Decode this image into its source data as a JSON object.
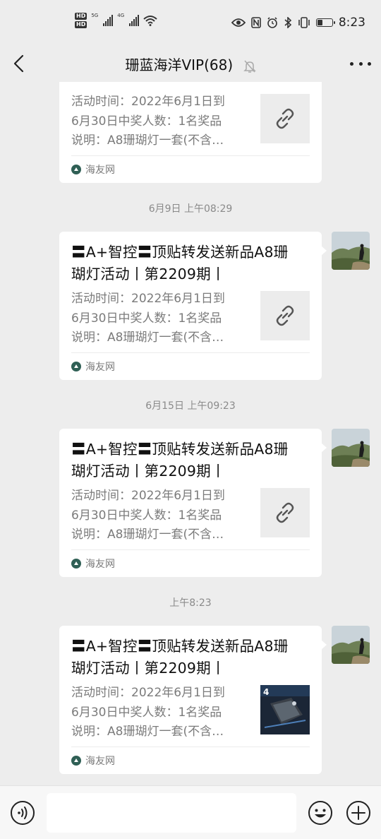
{
  "status_bar": {
    "hd_labels": [
      "HD",
      "HD"
    ],
    "net1": "5G",
    "net2": "4G",
    "time": "8:23",
    "battery_level": 0.35
  },
  "nav": {
    "title": "珊蓝海洋VIP(68)"
  },
  "messages": [
    {
      "title": "",
      "desc": [
        "活动时间：2022年6月1日到",
        "6月30日中奖人数：1名奖品",
        "说明：A8珊瑚灯一套(不含…"
      ],
      "thumb": "link-icon",
      "source": "海友网"
    },
    {
      "timestamp": "6月9日 上午08:29",
      "title": "〓A+智控〓顶贴转发送新品A8珊瑚灯活动丨第2209期丨",
      "title_lines": [
        "〓A+智控〓顶贴转发送新品A8珊",
        "瑚灯活动丨第2209期丨"
      ],
      "desc": [
        "活动时间：2022年6月1日到",
        "6月30日中奖人数：1名奖品",
        "说明：A8珊瑚灯一套(不含…"
      ],
      "thumb": "link-icon",
      "source": "海友网"
    },
    {
      "timestamp": "6月15日 上午09:23",
      "title_lines": [
        "〓A+智控〓顶贴转发送新品A8珊",
        "瑚灯活动丨第2209期丨"
      ],
      "desc": [
        "活动时间：2022年6月1日到",
        "6月30日中奖人数：1名奖品",
        "说明：A8珊瑚灯一套(不含…"
      ],
      "thumb": "link-icon",
      "source": "海友网"
    },
    {
      "timestamp": "上午8:23",
      "title_lines": [
        "〓A+智控〓顶贴转发送新品A8珊",
        "瑚灯活动丨第2209期丨"
      ],
      "desc": [
        "活动时间：2022年6月1日到",
        "6月30日中奖人数：1名奖品",
        "说明：A8珊瑚灯一套(不含…"
      ],
      "thumb": "product-image",
      "thumb_label": "4",
      "source": "海友网"
    }
  ],
  "input": {
    "placeholder": ""
  }
}
